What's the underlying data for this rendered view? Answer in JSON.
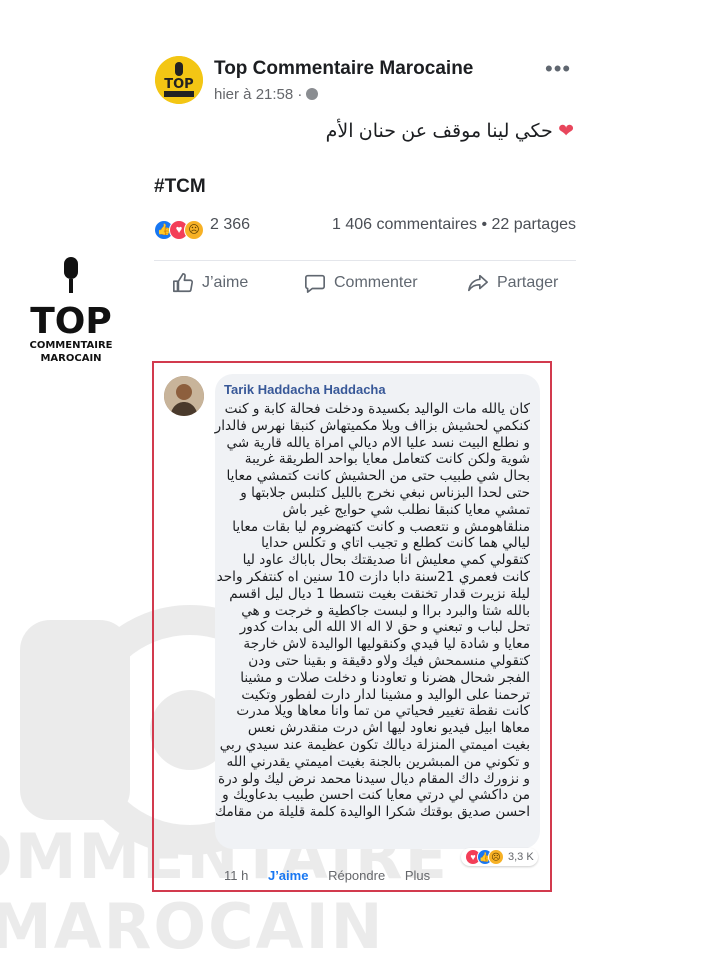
{
  "post": {
    "page_name": "Top Commentaire Marocaine",
    "time": "hier à 21:58 ·",
    "more": "•••",
    "text": "حكي لينا موقف عن حنان الأم",
    "hashtag": "#TCM"
  },
  "stats": {
    "reactions_count": "2 366",
    "comments_shares": "1 406 commentaires • 22 partages"
  },
  "actions": {
    "like": "J’aime",
    "comment": "Commenter",
    "share": "Partager"
  },
  "logo": {
    "line1": "TOP",
    "line2": "COMMENTAIRE",
    "line3": "MAROCAIN"
  },
  "watermark": {
    "line1": "OMMENTAIRE",
    "line2": "MAROCAIN"
  },
  "comment": {
    "author": "Tarik Haddacha Haddacha",
    "body_lines": [
      "كان يالله مات الواليد بكسيدة ودخلت فحالة كابة و كنت",
      "كنكمي لحشيش بزااف ويلا مكميتهاش كنبقا نهرس فالدار",
      "و نطلع البيت نسد عليا الام ديالي امراة يالله قارية شي",
      "شوية ولكن كانت كتعامل معايا بواحد الطريقة غريبة",
      "بحال شي طبيب حتى من الحشيش كانت كتمشي معايا",
      "حتى لحدا البزناس نبغي نخرج بالليل كتلبس جلابتها و",
      "تمشي معايا كنبقا نطلب شي حوايج غير باش",
      "منلقاهومش و نتعصب و كانت كتهضروم ليا بقات معايا",
      "ليالي هما كانت كطلع و تجيب اتاي و تكلس حدايا",
      "كتقولي كمي معليش انا صديقتك بحال باباك عاود ليا",
      "كانت فعمري 21سنة دابا دازت 10 سنين اه كنتفكر واحد",
      "ليلة نزيرت قدار تخنقت بغيت نتسطا 1 ديال ليل اقسم",
      "بالله شتا والبرد براا و لبست جاكطية و خرجت و هي",
      "تحل لباب و تبعني و حق لا اله الا الله الى بدات كدور",
      "معايا و شادة ليا فيدي وكنقوليها الواليدة لاش خارجة",
      "كتقولي منسمحش فيك ولاو دقيقة و بقينا حتى ودن",
      "الفجر شحال هضرنا و تعاودنا و دخلت صلات و مشينا",
      "ترحمنا على الواليد و مشينا لدار دارت لفطور وتكيت",
      "كانت نقطة تغيير فحياتي من تما وانا معاها ويلا مدرت",
      "معاها ابيل فيديو نعاود ليها اش درت منقدرش نعس",
      "بغيت اميمتي المنزلة ديالك تكون عظيمة عند سيدي ربي",
      "و تكوني من المبشرين بالجنة بغيت اميمتي يقدرني الله",
      "و نزورك داك المقام ديال سيدنا محمد نرض ليك ولو درة",
      "من داكشي لي درتي معايا كنت احسن طبيب بدعاويك و",
      "احسن صديق بوقتك شكرا الواليدة كلمة قليلة من مقامك"
    ],
    "reaction_count": "3,3 K",
    "time": "11 h",
    "like": "J’aime",
    "reply": "Répondre",
    "more": "Plus"
  },
  "colors": {
    "link_blue": "#385898",
    "frame_red": "#d23a4e",
    "like_blue": "#1877f2",
    "love_red": "#f33e58",
    "sad_yellow": "#f7b125"
  }
}
